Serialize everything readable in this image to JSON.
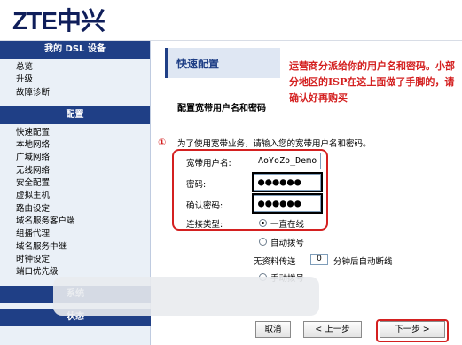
{
  "brand": {
    "logo": "ZTE中兴"
  },
  "sidebar": {
    "section1_title": "我的 DSL 设备",
    "section1_items": [
      {
        "label": "总览"
      },
      {
        "label": "升级"
      },
      {
        "label": "故障诊断"
      }
    ],
    "section2_title": "配置",
    "section2_items": [
      {
        "label": "快速配置"
      },
      {
        "label": "本地网络"
      },
      {
        "label": "广域网络"
      },
      {
        "label": "无线网络"
      },
      {
        "label": "安全配置"
      },
      {
        "label": "虚拟主机"
      },
      {
        "label": "路由设定"
      },
      {
        "label": "域名服务客户端"
      },
      {
        "label": "组播代理"
      },
      {
        "label": "域名服务中继"
      },
      {
        "label": "时钟设定"
      },
      {
        "label": "端口优先级"
      }
    ],
    "section3_title": "系统",
    "section4_title": "状态"
  },
  "main": {
    "page_title": "快速配置",
    "notice": "运营商分派给你的用户名和密码。小部分地区的ISP在这上面做了手脚的，请确认好再购买",
    "section_title": "配置宽带用户名和密码",
    "marker": "①",
    "intro": "为了使用宽带业务，请输入您的宽带用户名和密码。",
    "username_label": "宽带用户名:",
    "username_value": "AoYoZo_Demo",
    "password_label": "密码:",
    "password_value": "●●●●●●",
    "confirm_label": "确认密码:",
    "confirm_value": "●●●●●●",
    "conn_type_label": "连接类型:",
    "conn_options": {
      "always_on": "一直在线",
      "auto_dial": "自动拨号",
      "manual_dial": "手动拨号"
    },
    "auto_disconnect_prefix": "无资料传送",
    "auto_disconnect_value": "0",
    "auto_disconnect_suffix": "分钟后自动断线",
    "buttons": {
      "cancel": "取消",
      "prev": "< 上一步",
      "next": "下一步 >"
    }
  }
}
